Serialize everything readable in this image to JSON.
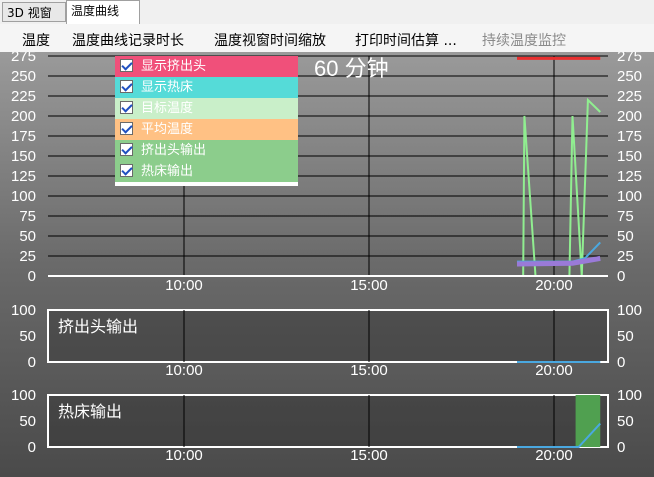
{
  "tabs": [
    "3D 视窗",
    "温度曲线"
  ],
  "menu": [
    {
      "label": "温度",
      "enabled": true
    },
    {
      "label": "温度曲线记录时长",
      "enabled": true
    },
    {
      "label": "温度视窗时间缩放",
      "enabled": true
    },
    {
      "label": "打印时间估算 ...",
      "enabled": true
    },
    {
      "label": "持续温度监控",
      "enabled": false
    }
  ],
  "top_title": "60 分钟",
  "legend": [
    {
      "label": "显示挤出头",
      "checked": true,
      "color": "#f0507a"
    },
    {
      "label": "显示热床",
      "checked": true,
      "color": "#55dbd8"
    },
    {
      "label": "目标温度",
      "checked": true,
      "color": "#c9efc9"
    },
    {
      "label": "平均温度",
      "checked": true,
      "color": "#ffc184"
    },
    {
      "label": "挤出头输出",
      "checked": true,
      "color": "#8ccd8c"
    },
    {
      "label": "热床输出",
      "checked": true,
      "color": "#8ccd8c"
    }
  ],
  "panels": {
    "extruder_output": {
      "title": "挤出头输出"
    },
    "bed_output": {
      "title": "热床输出"
    }
  },
  "chart_data": [
    {
      "type": "line",
      "x_ticks": [
        "10:00",
        "15:00",
        "20:00"
      ],
      "y_ticks": [
        0,
        25,
        50,
        75,
        100,
        125,
        150,
        175,
        200,
        225,
        250,
        275
      ],
      "ylim": [
        0,
        275
      ],
      "grid": true,
      "legend_position": "top-left",
      "series": [
        {
          "name": "显示挤出头",
          "color": "#e83030",
          "x": [
            "19:00",
            "21:15"
          ],
          "values": [
            272,
            272
          ]
        },
        {
          "name": "目标温度",
          "color": "#90ee90",
          "x": [
            "19:00",
            "19:10",
            "19:12",
            "19:30",
            "20:25",
            "20:30",
            "20:45",
            "20:55",
            "21:15"
          ],
          "values": [
            0,
            0,
            200,
            0,
            0,
            200,
            0,
            220,
            205
          ]
        },
        {
          "name": "显示热床",
          "color": "#4aa8e0",
          "x": [
            "19:00",
            "20:30",
            "20:50",
            "21:15"
          ],
          "values": [
            18,
            18,
            22,
            42
          ]
        },
        {
          "name": "平均温度",
          "color": "#9a7ad8",
          "x": [
            "19:00",
            "20:30",
            "21:15"
          ],
          "values": [
            15,
            16,
            22
          ]
        }
      ]
    },
    {
      "type": "line",
      "title": "挤出头输出",
      "x_ticks": [
        "10:00",
        "15:00",
        "20:00"
      ],
      "y_ticks": [
        0,
        50,
        100
      ],
      "ylim": [
        0,
        100
      ],
      "series": [
        {
          "name": "挤出头输出",
          "color": "#4aa8e0",
          "x": [
            "19:00",
            "21:15"
          ],
          "values": [
            0,
            0
          ]
        }
      ]
    },
    {
      "type": "area",
      "title": "热床输出",
      "x_ticks": [
        "10:00",
        "15:00",
        "20:00"
      ],
      "y_ticks": [
        0,
        50,
        100
      ],
      "ylim": [
        0,
        100
      ],
      "series": [
        {
          "name": "热床输出",
          "color": "#50a050",
          "x": [
            "20:35",
            "21:15"
          ],
          "values": [
            100,
            100
          ]
        },
        {
          "name": "挤出头",
          "color": "#4aa8e0",
          "x": [
            "19:00",
            "20:40",
            "21:15"
          ],
          "values": [
            0,
            0,
            45
          ]
        }
      ]
    }
  ]
}
